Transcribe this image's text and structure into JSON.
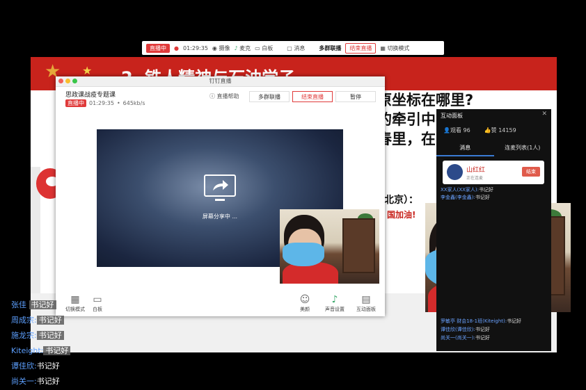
{
  "toolbar": {
    "live_badge": "直播中",
    "timer": "01:29:35",
    "items": [
      "摄像",
      "麦克",
      "白板",
      "消息"
    ],
    "multi_group": "多群联播",
    "end_live": "结束直播",
    "switch_mode": "切换模式"
  },
  "slide": {
    "banner_title": "2. 铁人精神与石油学子",
    "question_lines": [
      "原坐标在哪里?",
      "的牵引中",
      "春里，在"
    ],
    "beijing_text": "北京）：",
    "jiayou_text": "国加油!"
  },
  "window": {
    "title": "钉钉直播",
    "course_name": "思政课战疫专题课",
    "live_badge": "直播中",
    "timer": "01:29:35",
    "bitrate": "645kb/s",
    "help": "直播帮助",
    "multi_group": "多群联播",
    "end_live": "结束直播",
    "pause": "暂停",
    "share_text": "屏幕分享中 ...",
    "bottom": {
      "mode_label": "切换模式",
      "whiteboard": "白板",
      "beauty": "美颜",
      "sound": "声音设置",
      "panel": "互动面板"
    }
  },
  "panel": {
    "title": "互动面板",
    "viewers": "观看 96",
    "likes": "赞 14159",
    "tab_messages": "消息",
    "tab_connect": "连麦列表(1人)",
    "user_name": "山红红",
    "user_status": "正在连麦",
    "end_button": "结束",
    "top_messages": [
      {
        "who": "XX家人(XX家人):",
        "text": "书记好"
      },
      {
        "who": "李金鑫(李金鑫):",
        "text": "书记好"
      }
    ],
    "bottom_messages": [
      {
        "who": "罗敏亭 财会18-1班(Kiteight):",
        "text": "书记好"
      },
      {
        "who": "谭佳欣(谭佳欣):",
        "text": "书记好"
      },
      {
        "who": "尚关一(尚关一):",
        "text": "书记好"
      }
    ]
  },
  "chat_overlay": [
    {
      "who": "张佳",
      "text": "书记好"
    },
    {
      "who": "周成宗:",
      "text": "书记好"
    },
    {
      "who": "施龙宗:",
      "text": "书记好"
    },
    {
      "who": "Kiteight:",
      "text": "书记好"
    },
    {
      "who": "谭佳欣:",
      "text": "书记好"
    },
    {
      "who": "尚关一:",
      "text": "书记好"
    }
  ],
  "icons": {
    "camera": "camera-icon",
    "mic": "microphone-icon",
    "whiteboard": "whiteboard-icon",
    "message": "message-icon",
    "switch": "grid-icon",
    "screen_share": "screen-share-icon",
    "beauty": "face-icon",
    "sound": "microphone-icon",
    "panel": "chat-icon"
  },
  "colors": {
    "live_red": "#e03a3a",
    "banner_red": "#c8231c",
    "accent_blue": "#3a7bd5"
  }
}
